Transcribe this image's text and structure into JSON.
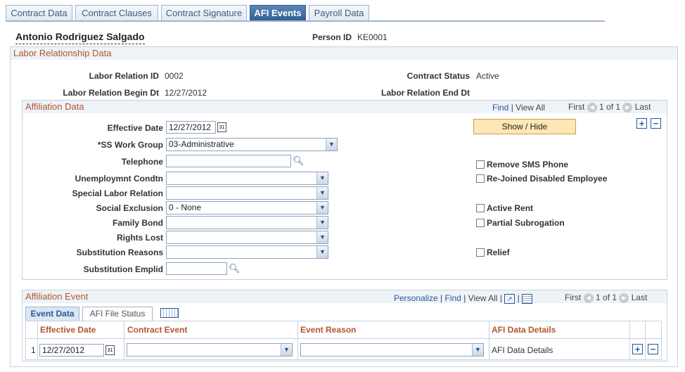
{
  "tabs": [
    {
      "label": "Contract Data",
      "active": false
    },
    {
      "label": "Contract Clauses",
      "active": false
    },
    {
      "label": "Contract Signature",
      "active": false
    },
    {
      "label": "AFI Events",
      "active": true
    },
    {
      "label": "Payroll Data",
      "active": false
    }
  ],
  "header": {
    "employee_name": "Antonio Rodriguez Salgado",
    "person_id_label": "Person ID",
    "person_id": "KE0001"
  },
  "labor": {
    "section_title": "Labor Relationship Data",
    "relation_id_label": "Labor Relation ID",
    "relation_id": "0002",
    "contract_status_label": "Contract Status",
    "contract_status": "Active",
    "begin_dt_label": "Labor Relation Begin Dt",
    "begin_dt": "12/27/2012",
    "end_dt_label": "Labor Relation End Dt",
    "end_dt": ""
  },
  "affiliation": {
    "section_title": "Affiliation Data",
    "nav": {
      "find": "Find",
      "sep": "|",
      "view_all": "View All",
      "first": "First",
      "range": "1 of 1",
      "last": "Last"
    },
    "show_hide_label": "Show / Hide",
    "fields": {
      "effective_date_label": "Effective Date",
      "effective_date": "12/27/2012",
      "ss_work_group_label": "*SS Work Group",
      "ss_work_group": "03-Administrative",
      "telephone_label": "Telephone",
      "telephone": "",
      "unemployment_label": "Unemploymnt Condtn",
      "unemployment": "",
      "special_labor_label": "Special Labor Relation",
      "special_labor": "",
      "social_exclusion_label": "Social Exclusion",
      "social_exclusion": "0 - None",
      "family_bond_label": "Family Bond",
      "family_bond": "",
      "rights_lost_label": "Rights Lost",
      "rights_lost": "",
      "substitution_reasons_label": "Substitution Reasons",
      "substitution_reasons": "",
      "substitution_emplid_label": "Substitution Emplid",
      "substitution_emplid": ""
    },
    "checkboxes": {
      "remove_sms": "Remove SMS Phone",
      "rejoined": "Re-Joined Disabled Employee",
      "active_rent": "Active Rent",
      "partial_subrogation": "Partial Subrogation",
      "relief": "Relief"
    }
  },
  "event": {
    "section_title": "Affiliation Event",
    "nav": {
      "personalize": "Personalize",
      "sep": "|",
      "find": "Find",
      "view_all": "View All",
      "first": "First",
      "range": "1 of 1",
      "last": "Last"
    },
    "subtabs": [
      "Event Data",
      "AFI File Status"
    ],
    "columns": [
      "Effective Date",
      "Contract Event",
      "Event Reason",
      "AFI Data Details"
    ],
    "rows": [
      {
        "num": "1",
        "effective_date": "12/27/2012",
        "contract_event": "",
        "event_reason": "",
        "afi_details": "AFI Data Details"
      }
    ]
  },
  "icons": {
    "calendar": "calendar-icon",
    "lookup": "magnifier-icon",
    "dropdown": "chevron-down-icon",
    "add": "plus-icon",
    "delete": "minus-icon",
    "prev": "arrow-left-icon",
    "next": "arrow-right-icon",
    "zoom": "zoom-icon",
    "download": "grid-download-icon",
    "show_all_columns": "show-columns-icon"
  },
  "colors": {
    "section_title": "#b0562d",
    "link": "#2b5798",
    "active_tab": "#2f5f94",
    "button_bg": "#fde7b4"
  }
}
